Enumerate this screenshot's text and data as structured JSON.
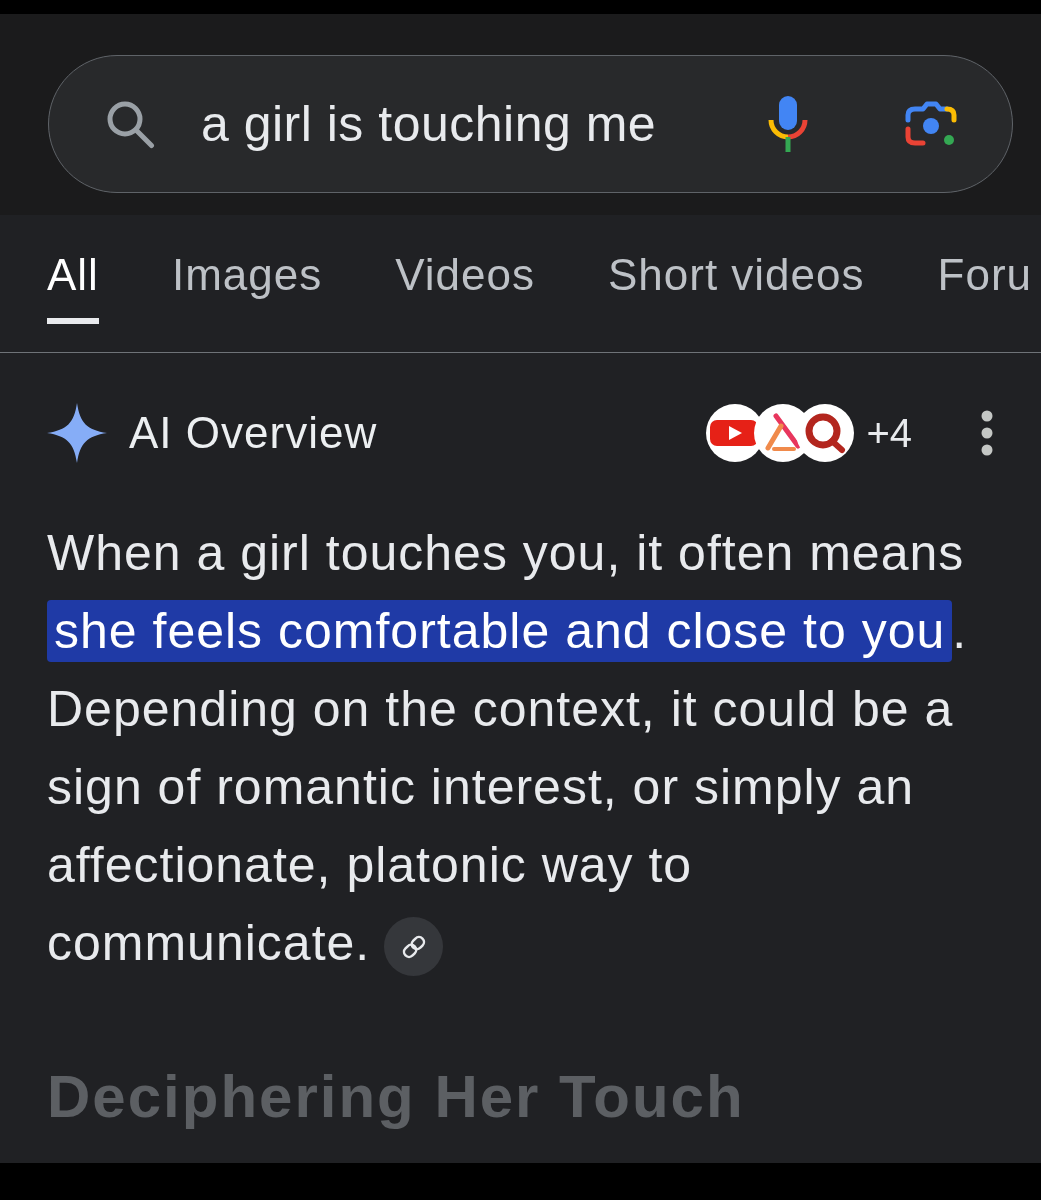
{
  "search": {
    "value": "a girl is touching me"
  },
  "tabs": [
    {
      "label": "All",
      "selected": true
    },
    {
      "label": "Images",
      "selected": false
    },
    {
      "label": "Videos",
      "selected": false
    },
    {
      "label": "Short videos",
      "selected": false
    },
    {
      "label": "Foru",
      "selected": false
    }
  ],
  "overview": {
    "title": "AI Overview",
    "more_sources": "+4",
    "paragraph": [
      {
        "text": "When a girl touches you, it often means ",
        "highlighted": false
      },
      {
        "text": "she feels comfortable and close to you",
        "highlighted": true
      },
      {
        "text": ". Depending on the context, it could be a sign of romantic interest, or simply an affectionate, platonic way to communicate.",
        "highlighted": false
      }
    ]
  },
  "section_heading": "Deciphering Her Touch"
}
